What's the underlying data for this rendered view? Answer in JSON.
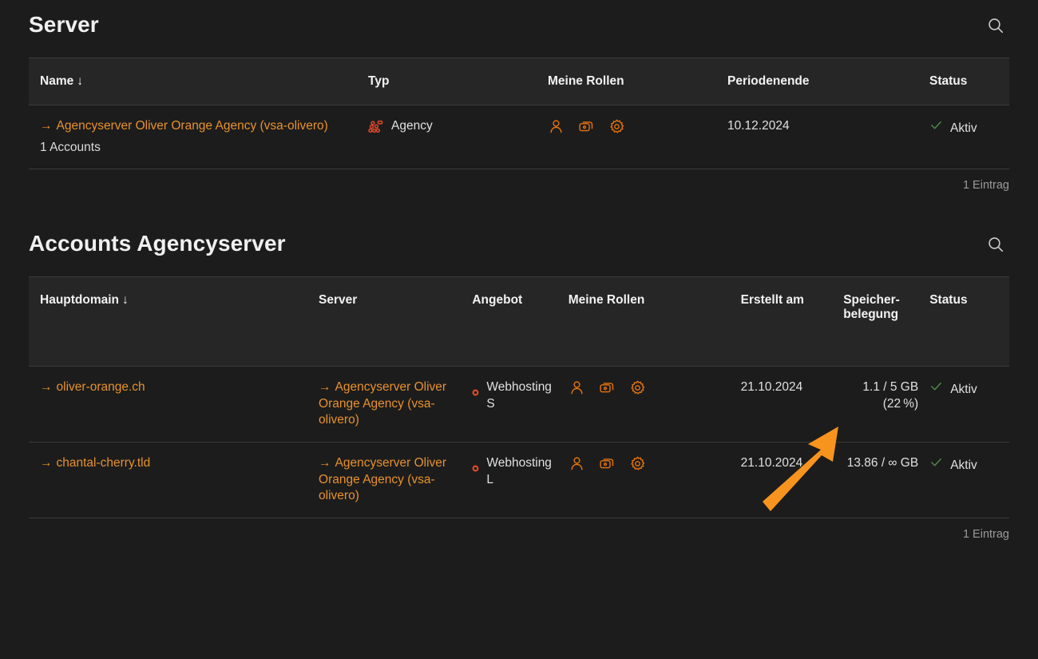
{
  "theme": {
    "bg": "#1c1c1c",
    "header_bg": "#262626",
    "border": "#3a3a3a",
    "accent_orange": "#e8912d",
    "annotation_orange": "#f7941e",
    "status_green": "#4a8c4a",
    "agency_red": "#e04a28",
    "text_primary": "#e6e6e6",
    "text_muted": "#9a9a9a"
  },
  "server_section": {
    "title": "Server",
    "search_icon": "search-icon",
    "columns": [
      {
        "label": "Name",
        "sort": "↓"
      },
      {
        "label": "Typ",
        "sort": ""
      },
      {
        "label": "Meine Rollen",
        "sort": ""
      },
      {
        "label": "Periodenende",
        "sort": ""
      },
      {
        "label": "Status",
        "sort": ""
      }
    ],
    "rows": [
      {
        "name": "Agencyserver Oliver Orange Agency (vsa-olivero)",
        "name_arrow": "→",
        "sub_note": "1 Accounts",
        "type": "Agency",
        "type_icon": "agency-cluster-icon",
        "roles": [
          "user-icon",
          "cards-icon",
          "gear-icon"
        ],
        "period_end": "10.12.2024",
        "status": "Aktiv",
        "status_icon": "check-icon"
      }
    ],
    "footer": "1 Eintrag"
  },
  "accounts_section": {
    "title": "Accounts Agencyserver",
    "search_icon": "search-icon",
    "columns": [
      {
        "label": "Hauptdomain",
        "sort": "↓"
      },
      {
        "label": "Server",
        "sort": ""
      },
      {
        "label": "Angebot",
        "sort": ""
      },
      {
        "label": "Meine Rollen",
        "sort": ""
      },
      {
        "label": "Erstellt am",
        "sort": ""
      },
      {
        "label": "Speicher-belegung",
        "sort": ""
      },
      {
        "label": "Status",
        "sort": ""
      }
    ],
    "rows": [
      {
        "domain": "oliver-orange.ch",
        "domain_arrow": "→",
        "server": "Agencyserver Oliver Orange Agency (vsa-olivero)",
        "server_arrow": "→",
        "offer": "Webhosting S",
        "offer_icon": "ring-bullet-icon",
        "roles": [
          "user-icon",
          "cards-icon",
          "gear-icon"
        ],
        "created_at": "21.10.2024",
        "storage": "1.1 / 5 GB (22 %)",
        "status": "Aktiv",
        "status_icon": "check-icon"
      },
      {
        "domain": "chantal-cherry.tld",
        "domain_arrow": "→",
        "server": "Agencyserver Oliver Orange Agency (vsa-olivero)",
        "server_arrow": "→",
        "offer": "Webhosting L",
        "offer_icon": "ring-bullet-icon",
        "roles": [
          "user-icon",
          "cards-icon",
          "gear-icon"
        ],
        "created_at": "21.10.2024",
        "storage": "13.86 / ∞ GB",
        "status": "Aktiv",
        "status_icon": "check-icon"
      }
    ],
    "footer": "1 Eintrag"
  },
  "annotation": {
    "name": "pointer-arrow-annotation",
    "points_at": "storage-value-row-1"
  }
}
